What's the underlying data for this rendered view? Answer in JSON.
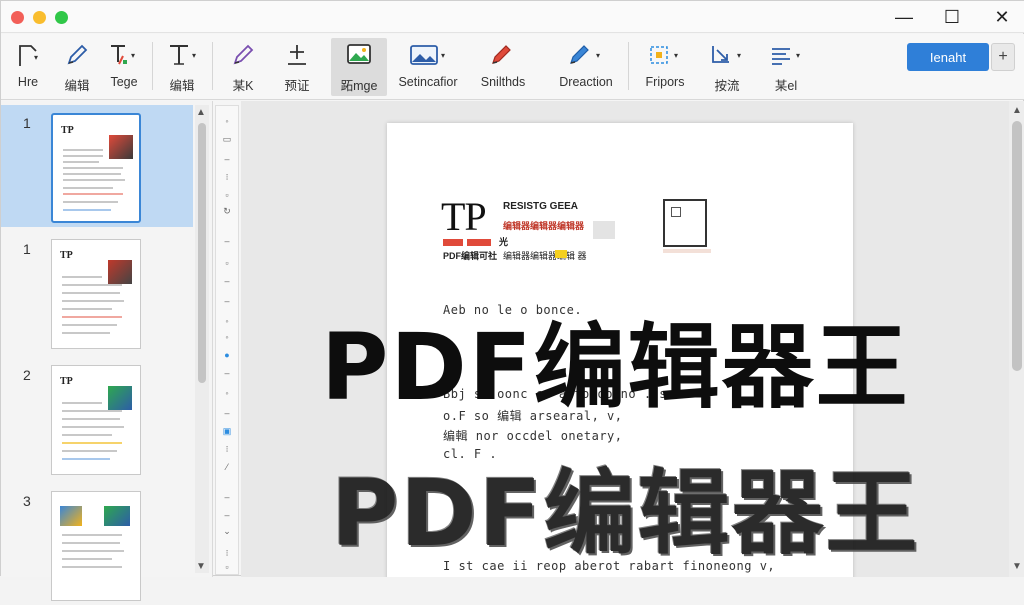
{
  "window": {
    "controls": {
      "minimize": "—",
      "maximize": "☐",
      "close": "✕"
    }
  },
  "toolbar": {
    "tools": [
      {
        "label": "Hre",
        "icon": "select-corner-icon"
      },
      {
        "label": "编辑",
        "icon": "pen-icon"
      },
      {
        "label": "Tege",
        "icon": "text-format-icon"
      },
      {
        "label": "编辑",
        "icon": "text-icon"
      },
      {
        "label": "某K",
        "icon": "marker-icon"
      },
      {
        "label": "预证",
        "icon": "add-line-icon"
      },
      {
        "label": "跖mge",
        "icon": "image-icon"
      },
      {
        "label": "Setincafior",
        "icon": "image-insert-icon"
      },
      {
        "label": "Snilthds",
        "icon": "red-pen-icon"
      },
      {
        "label": "Dreaction",
        "icon": "blue-pen-icon"
      },
      {
        "label": "Fripors",
        "icon": "crop-icon"
      },
      {
        "label": "按流",
        "icon": "transform-icon"
      },
      {
        "label": "某el",
        "icon": "list-icon"
      }
    ],
    "primary_button": "Ienaht",
    "plus": "+"
  },
  "sidebar": {
    "pages": [
      {
        "number": "1"
      },
      {
        "number": "1"
      },
      {
        "number": "2"
      },
      {
        "number": "3"
      }
    ]
  },
  "document": {
    "heading": "TP",
    "sub1": "RESISTG GEEA",
    "sub2": "编辑器编辑器编辑器",
    "sub3": "PDF编辑可社",
    "sub4": "编辑器编辑器编辑 器",
    "mark": "光",
    "lines": [
      "Aeb  no   le   o  bonce.",
      "Bbj s. oonc  cn  altoioo no  . s  c",
      "o.F  so  编辑 arsearal,  v,",
      "编輯 nor  occdel onetary,",
      "cl.   F  ."
    ],
    "bottom_line": "I  st cae  ii  reop aberot  rabart  finoneong v,"
  },
  "overlay": {
    "title_top": "PDF编辑器王",
    "title_bottom": "PDF编辑器王"
  },
  "colors": {
    "accent": "#2f7fd8",
    "selection": "#bfd9f3",
    "red": "#e04a3a"
  }
}
